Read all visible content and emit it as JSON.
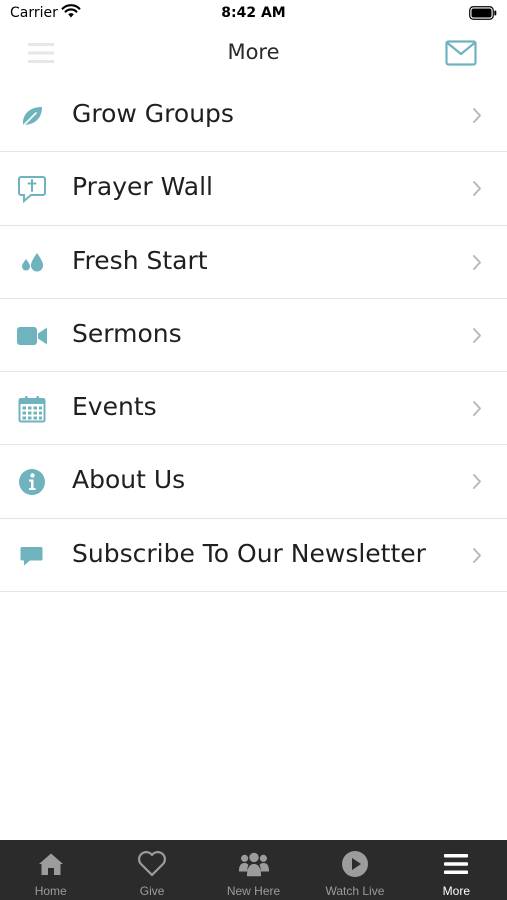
{
  "status_bar": {
    "carrier": "Carrier",
    "time": "8:42 AM"
  },
  "nav": {
    "title": "More",
    "icons": {
      "left": "hamburger-icon",
      "right": "mail-icon"
    }
  },
  "colors": {
    "accent": "#6fb3bf",
    "tab_bar": "#2b2b2b",
    "tab_inactive": "#9c9c9c",
    "tab_active": "#ffffff"
  },
  "menu": {
    "items": [
      {
        "label": "Grow Groups",
        "icon": "leaf-icon"
      },
      {
        "label": "Prayer Wall",
        "icon": "prayer-bubble-icon"
      },
      {
        "label": "Fresh Start",
        "icon": "droplets-icon"
      },
      {
        "label": "Sermons",
        "icon": "video-camera-icon"
      },
      {
        "label": "Events",
        "icon": "calendar-icon"
      },
      {
        "label": "About Us",
        "icon": "info-icon"
      },
      {
        "label": "Subscribe To Our Newsletter",
        "icon": "chat-bubble-icon"
      }
    ]
  },
  "tabs": [
    {
      "label": "Home",
      "icon": "home-icon",
      "active": false
    },
    {
      "label": "Give",
      "icon": "heart-icon",
      "active": false
    },
    {
      "label": "New Here",
      "icon": "group-icon",
      "active": false
    },
    {
      "label": "Watch Live",
      "icon": "play-icon",
      "active": false
    },
    {
      "label": "More",
      "icon": "hamburger-icon",
      "active": true
    }
  ]
}
